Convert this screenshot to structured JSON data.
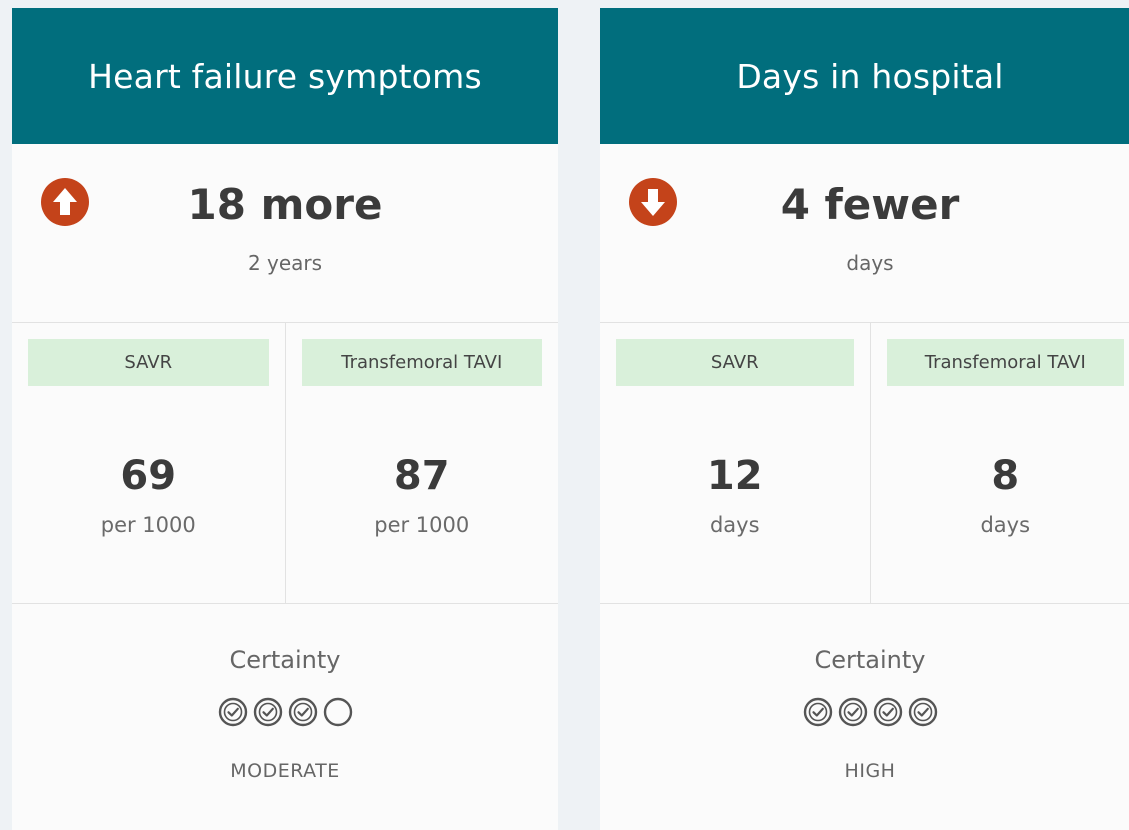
{
  "cards": [
    {
      "title": "Heart failure symptoms",
      "direction": "up",
      "icon": "arrow-up-circle-icon",
      "summary": "18 more",
      "summary_sub": "2 years",
      "comparisons": [
        {
          "label": "SAVR",
          "value": "69",
          "unit": "per 1000"
        },
        {
          "label": "Transfemoral TAVI",
          "value": "87",
          "unit": "per 1000"
        }
      ],
      "certainty": {
        "label": "Certainty",
        "filled": 3,
        "total": 4,
        "level": "MODERATE"
      }
    },
    {
      "title": "Days in hospital",
      "direction": "down",
      "icon": "arrow-down-circle-icon",
      "summary": "4 fewer",
      "summary_sub": "days",
      "comparisons": [
        {
          "label": "SAVR",
          "value": "12",
          "unit": "days"
        },
        {
          "label": "Transfemoral TAVI",
          "value": "8",
          "unit": "days"
        }
      ],
      "certainty": {
        "label": "Certainty",
        "filled": 4,
        "total": 4,
        "level": "HIGH"
      }
    }
  ],
  "colors": {
    "header": "#016e7d",
    "arrow": "#c4431a",
    "tag": "#d9f0da"
  }
}
